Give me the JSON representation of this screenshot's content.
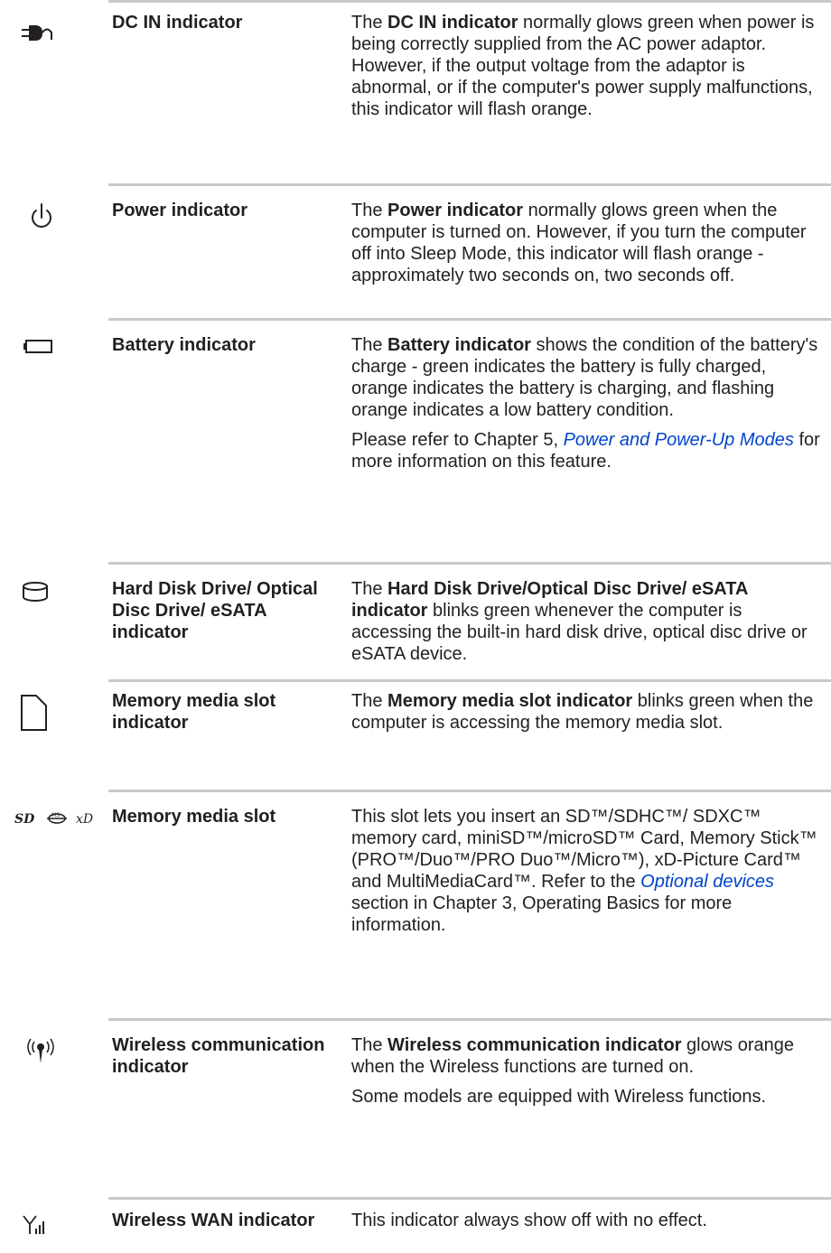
{
  "rows": [
    {
      "term": "DC IN indicator",
      "icon": "dc-in-plug-icon",
      "desc": {
        "pre": "The ",
        "bold": "DC IN indicator",
        "post": " normally glows green when power is being correctly supplied from the AC power adaptor. However, if the output voltage from the adaptor is abnormal, or if the computer's power supply malfunctions, this indicator will flash orange."
      }
    },
    {
      "term": "Power indicator",
      "icon": "power-icon",
      "desc": {
        "pre": "The ",
        "bold": "Power indicator",
        "post": " normally glows green when the computer is turned on. However, if you turn the computer off into Sleep Mode, this indicator will flash orange - approximately two seconds on, two seconds off."
      }
    },
    {
      "term": "Battery indicator",
      "icon": "battery-icon",
      "desc": {
        "pre": "The ",
        "bold": "Battery indicator",
        "post": " shows the condition of the battery's charge - green indicates the battery is fully charged, orange indicates the battery is charging, and flashing orange indicates a low battery condition."
      },
      "desc2": {
        "pre": "Please refer to Chapter 5, ",
        "link": "Power and Power-Up Modes",
        "post": " for more information on this feature."
      }
    },
    {
      "term": "Hard Disk Drive/ Optical Disc Drive/ eSATA indicator",
      "icon": "hard-disk-icon",
      "desc": {
        "pre": "The ",
        "bold": "Hard Disk Drive/Optical Disc Drive/ eSATA indicator",
        "post": " blinks green whenever the computer is accessing the built-in hard disk drive, optical disc drive or eSATA device."
      }
    },
    {
      "term": "Memory media slot indicator",
      "icon": "memory-card-icon",
      "desc": {
        "pre": "The ",
        "bold": "Memory media slot indicator",
        "post": " blinks green when the computer is accessing the memory media slot."
      }
    },
    {
      "term": "Memory media slot",
      "icon": "sd-ms-xd-logos-icon",
      "icon_text": {
        "sd": "SD",
        "ms": "MS",
        "xd": "xD"
      },
      "desc": {
        "pre": "This slot lets you insert an SD™/SDHC™/ SDXC™ memory card, miniSD™/microSD™ Card, Memory Stick™ (PRO™/Duo™/PRO Duo™/Micro™), xD-Picture Card™ and MultiMediaCard™. Refer to the ",
        "link": "Optional devices",
        "post": " section in Chapter 3, Operating Basics for more information."
      }
    },
    {
      "term": "Wireless communication indicator",
      "icon": "wireless-antenna-icon",
      "desc": {
        "pre": "The ",
        "bold": "Wireless communication indicator",
        "post": " glows orange when the Wireless functions are turned on."
      },
      "desc2": {
        "text": "Some models are equipped with Wireless functions."
      }
    },
    {
      "term": "Wireless WAN indicator",
      "icon": "wireless-wan-signal-icon",
      "desc": {
        "text": "This indicator always show off with no effect."
      }
    }
  ]
}
